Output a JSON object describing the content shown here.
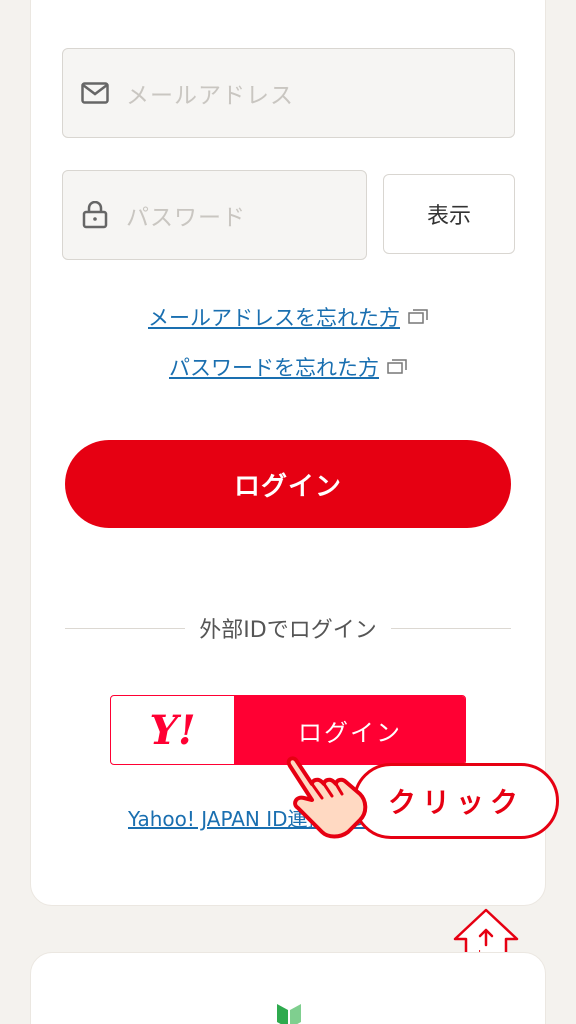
{
  "form": {
    "email_placeholder": "メールアドレス",
    "password_placeholder": "パスワード",
    "show_label": "表示"
  },
  "links": {
    "forgot_email": "メールアドレスを忘れた方",
    "forgot_password": "パスワードを忘れた方"
  },
  "login_label": "ログイン",
  "external": {
    "divider_label": "外部IDでログイン",
    "yahoo_logo_text": "Y!",
    "yahoo_login_label": "ログイン",
    "yahoo_link": "Yahoo! JAPAN ID連携について"
  },
  "overlay": {
    "click_label": "クリック"
  },
  "to_top": {
    "label": "上へ"
  },
  "colors": {
    "primary_red": "#e60012",
    "yahoo_red": "#ff0033",
    "link_blue": "#1a6fb0"
  }
}
